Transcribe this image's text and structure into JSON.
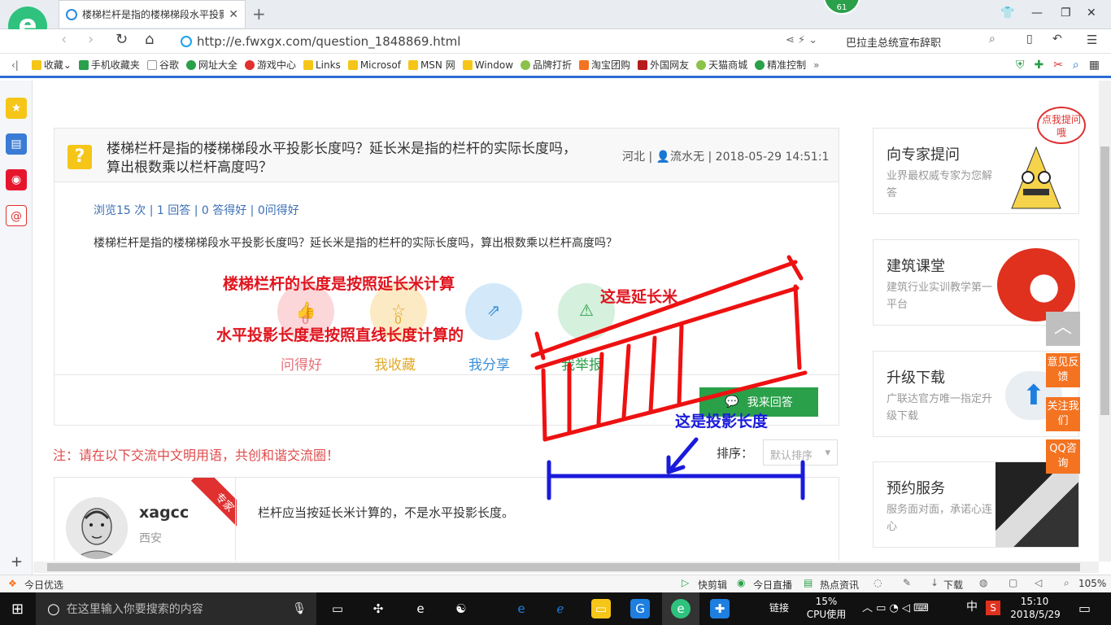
{
  "browser": {
    "tab_title": "楼梯栏杆是指的楼梯梯段水平投影长度吗？延长米是指的栏杆的实际长度吗，算出根数乘以栏杆高度吗？",
    "badge_count": "61",
    "url": "http://e.fwxgx.com/question_1848869.html",
    "search_text": "巴拉圭总统宣布辞职",
    "bookmarks": [
      "收藏",
      "手机收藏夹",
      "谷歌",
      "网址大全",
      "游戏中心",
      "Links",
      "Microsof",
      "MSN 网",
      "Window",
      "品牌打折",
      "淘宝团购",
      "外国网友",
      "天猫商城",
      "精准控制"
    ]
  },
  "question": {
    "title": "楼梯栏杆是指的楼梯梯段水平投影长度吗？延长米是指的栏杆的实际长度吗，算出根数乘以栏杆高度吗？",
    "meta": "河北 | 👤流水无 | 2018-05-29 14:51:1",
    "stats": "浏览15 次 | 1 回答 | 0 答得好 | 0问得好",
    "body": "楼梯栏杆是指的楼梯梯段水平投影长度吗？延长米是指的栏杆的实际长度吗，算出根数乘以栏杆高度吗？",
    "actions": {
      "good_question": "问得好",
      "favorite": "我收藏",
      "share": "我分享",
      "report": "我举报"
    },
    "counts": {
      "good_question": "0",
      "favorite": "0"
    },
    "answer_button": "我来回答"
  },
  "annotations": {
    "red1": "楼梯栏杆的长度是按照延长米计算",
    "red2": "水平投影长度是按照直线长度计算的",
    "red3": "这是延长米",
    "blue1": "这是投影长度"
  },
  "notice": "注：请在以下交流中文明用语，共创和谐交流圈！",
  "sort": {
    "label": "排序：",
    "value": "默认排序"
  },
  "answer": {
    "user": "xagcc",
    "location": "西安",
    "badge": "专家",
    "text": "栏杆应当按延长米计算的，不是水平投影长度。"
  },
  "sidebar": {
    "bubble": "点我提问哦",
    "cards": [
      {
        "title": "向专家提问",
        "sub": "业界最权威专家为您解答"
      },
      {
        "title": "建筑课堂",
        "sub": "建筑行业实训教学第一平台"
      },
      {
        "title": "升级下载",
        "sub": "广联达官方唯一指定升级下载"
      },
      {
        "title": "预约服务",
        "sub": "服务面对面，承诺心连心"
      }
    ],
    "float_buttons": [
      "意见反馈",
      "关注我们",
      "QQ咨询"
    ]
  },
  "statusbar": {
    "left": "今日优选",
    "items": [
      "快剪辑",
      "今日直播",
      "热点资讯",
      "下载"
    ],
    "zoom": "105%"
  },
  "taskbar": {
    "search_placeholder": "在这里输入你要搜索的内容",
    "link": "链接",
    "cpu_value": "15%",
    "cpu_label": "CPU使用",
    "ime": "中",
    "time": "15:10",
    "date": "2018/5/29"
  },
  "colors": {
    "accent_green": "#2aa04a",
    "annotation_red": "#e0141e",
    "annotation_blue": "#1a1adc",
    "float_orange": "#f47321"
  }
}
